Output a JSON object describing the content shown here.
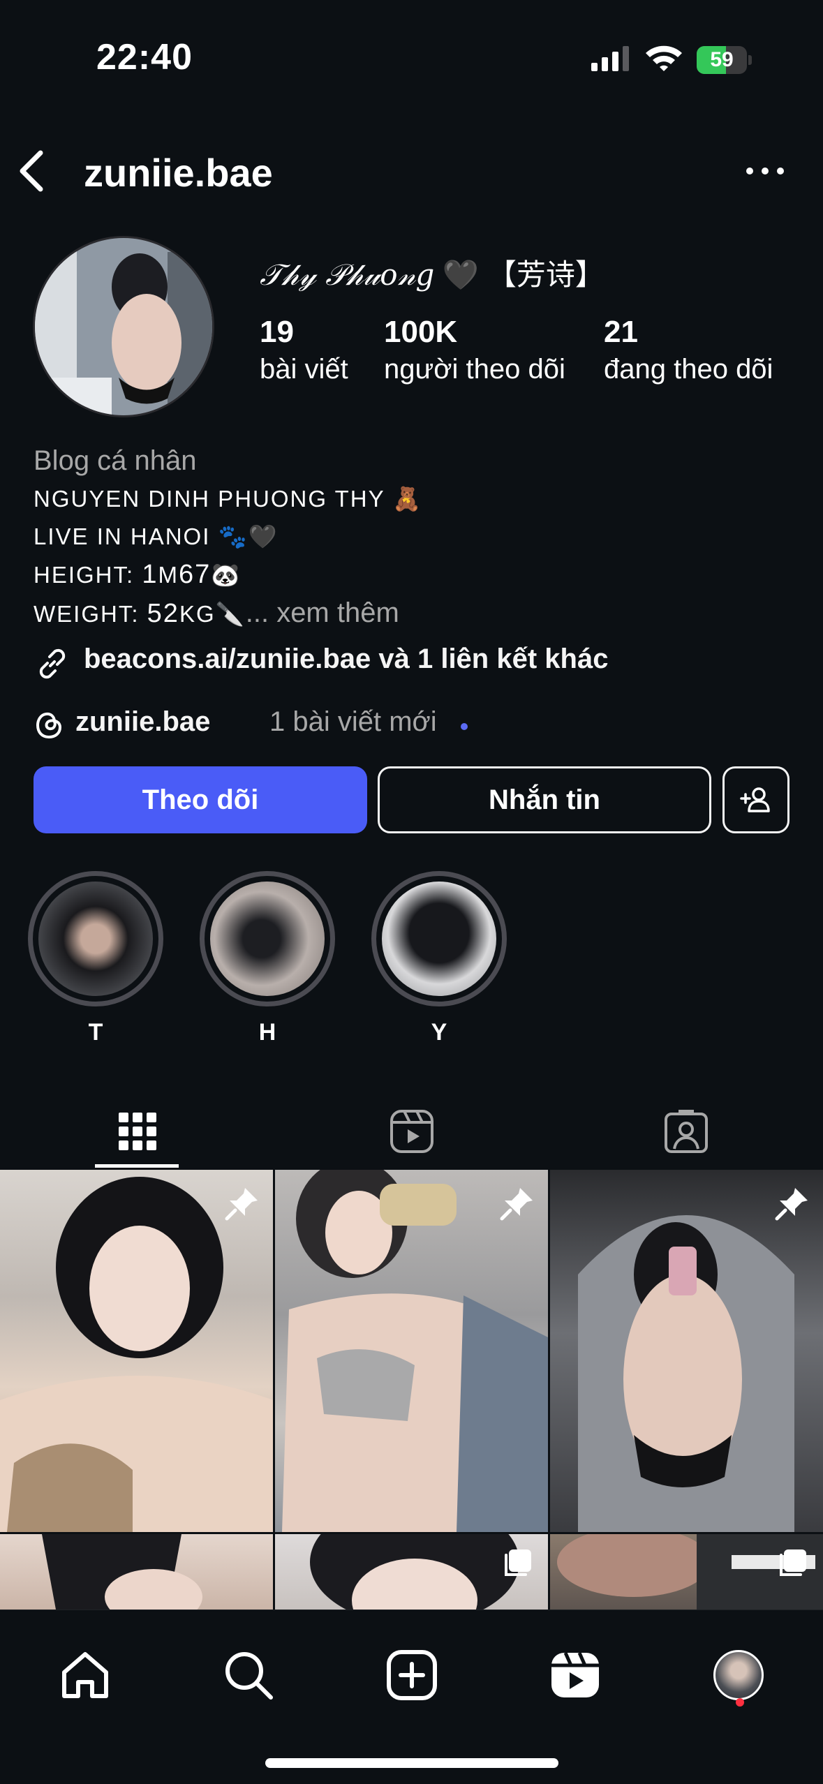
{
  "status_bar": {
    "time": "22:40",
    "battery_level": 59,
    "battery_text": "59"
  },
  "header": {
    "username": "zuniie.bae",
    "back_icon": "chevron-left-icon",
    "more_icon": "ellipsis-icon"
  },
  "profile": {
    "display_name_script": "𝒯𝒽𝓎 𝒫𝒽𝓊𝑜𝓃𝑔",
    "display_name_rest": "🖤 【芳诗】",
    "stats": [
      {
        "value": "19",
        "label": "bài viết"
      },
      {
        "value": "100K",
        "label": "người theo dõi"
      },
      {
        "value": "21",
        "label": "đang theo dõi"
      }
    ]
  },
  "bio": {
    "category": "Blog cá nhân",
    "line1": "Nguyen Dinh Phuong Thy 🧸",
    "line2": "Live in Hanoi 🐾🖤",
    "line3_prefix": "Height: ",
    "line3_num": "1",
    "line3_unit": "m",
    "line3_num2": "67",
    "line3_emoji": "🐼",
    "line4_prefix": "Weight: ",
    "line4_num": "52",
    "line4_unit": "kg",
    "line4_emoji": "🔪",
    "more_link": "... xem thêm"
  },
  "links": {
    "text": "beacons.ai/zuniie.bae và 1 liên kết khác",
    "icon": "link-icon"
  },
  "threads": {
    "username": "zuniie.bae",
    "note": "1 bài viết mới",
    "icon": "threads-icon"
  },
  "buttons": {
    "follow": "Theo dõi",
    "message": "Nhắn tin",
    "add_user_icon": "add-user-icon"
  },
  "highlights": [
    {
      "label": "T"
    },
    {
      "label": "H"
    },
    {
      "label": "Y"
    }
  ],
  "tabs": [
    {
      "name": "grid",
      "icon": "grid-icon",
      "active": true
    },
    {
      "name": "reels",
      "icon": "reels-icon",
      "active": false
    },
    {
      "name": "tagged",
      "icon": "tagged-person-icon",
      "active": false
    }
  ],
  "posts": [
    {
      "pinned": true,
      "multi": false
    },
    {
      "pinned": true,
      "multi": false
    },
    {
      "pinned": true,
      "multi": false
    },
    {
      "pinned": false,
      "multi": false
    },
    {
      "pinned": false,
      "multi": true
    },
    {
      "pinned": false,
      "multi": true
    }
  ],
  "bottom_nav": [
    {
      "name": "home",
      "icon": "home-icon"
    },
    {
      "name": "search",
      "icon": "search-icon"
    },
    {
      "name": "create",
      "icon": "plus-square-icon"
    },
    {
      "name": "reels",
      "icon": "reels-icon"
    },
    {
      "name": "profile",
      "icon": "avatar"
    }
  ],
  "colors": {
    "background": "#0c1014",
    "follow_button": "#4a5cf7",
    "battery": "#34c759",
    "notification_dot": "#ff3040"
  }
}
